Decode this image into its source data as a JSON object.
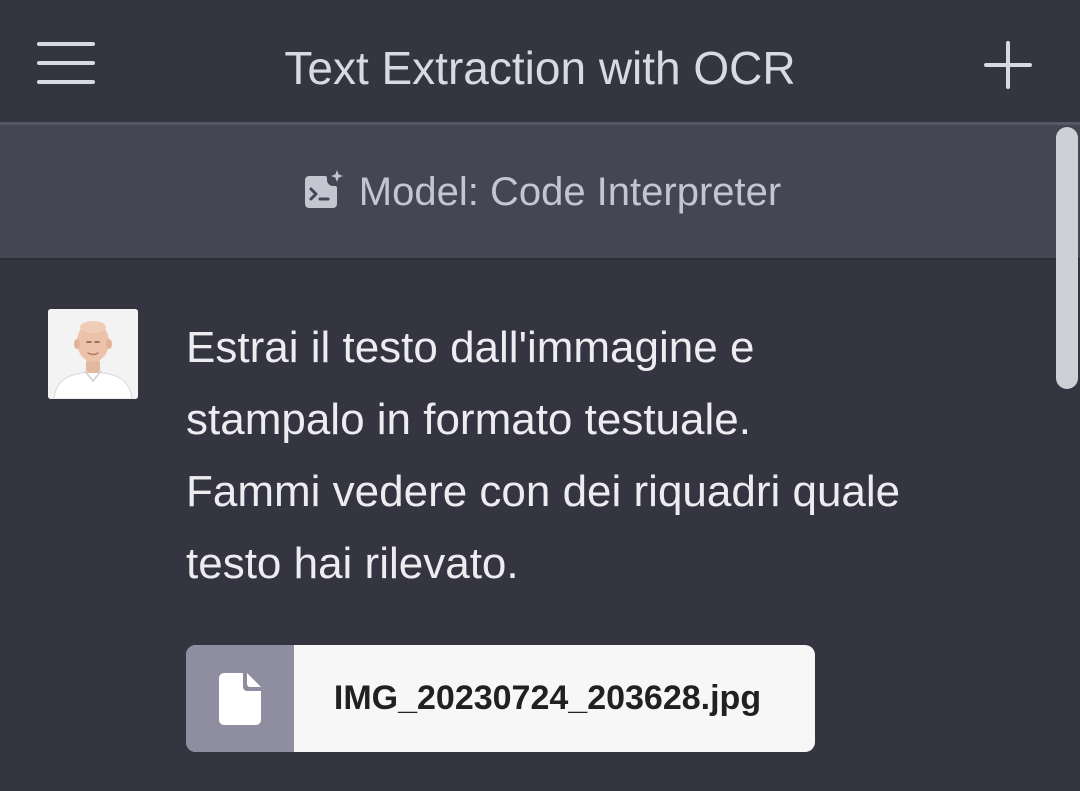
{
  "header": {
    "title": "Text Extraction with OCR",
    "menu_icon": "hamburger-menu-icon",
    "new_chat_icon": "plus-icon"
  },
  "model_banner": {
    "icon": "code-interpreter-icon",
    "label": "Model: Code Interpreter"
  },
  "message": {
    "role": "user",
    "avatar_icon": "user-avatar",
    "lines": [
      "Estrai il testo dall'immagine e",
      "stampalo in formato testuale.",
      "Fammi vedere con dei riquadri quale",
      "testo hai rilevato."
    ],
    "attachment": {
      "icon": "file-icon",
      "filename": "IMG_20230724_203628.jpg"
    }
  },
  "colors": {
    "background": "#343541",
    "banner": "#444654",
    "text": "#ececf1",
    "attachment_icon_bg": "#8e8ea0",
    "attachment_bg": "#f7f7f8"
  }
}
